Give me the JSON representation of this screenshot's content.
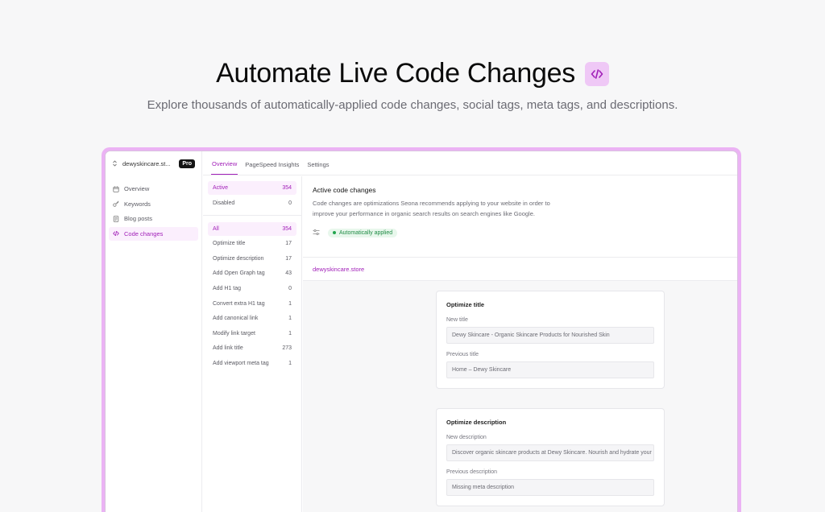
{
  "hero": {
    "title": "Automate Live Code Changes",
    "subtitle": "Explore thousands of automatically-applied code changes, social tags, meta tags, and descriptions.",
    "badge_icon": "code-icon"
  },
  "sidebar": {
    "site_name": "dewyskincare.st...",
    "plan_badge": "Pro",
    "items": [
      {
        "label": "Overview",
        "icon": "calendar-icon"
      },
      {
        "label": "Keywords",
        "icon": "key-icon"
      },
      {
        "label": "Blog posts",
        "icon": "document-icon"
      },
      {
        "label": "Code changes",
        "icon": "code-icon"
      }
    ]
  },
  "tabs": [
    {
      "label": "Overview"
    },
    {
      "label": "PageSpeed Insights"
    },
    {
      "label": "Settings"
    }
  ],
  "status_filters": [
    {
      "label": "Active",
      "count": "354"
    },
    {
      "label": "Disabled",
      "count": "0"
    }
  ],
  "type_filters": [
    {
      "label": "All",
      "count": "354"
    },
    {
      "label": "Optimize title",
      "count": "17"
    },
    {
      "label": "Optimize description",
      "count": "17"
    },
    {
      "label": "Add Open Graph tag",
      "count": "43"
    },
    {
      "label": "Add H1 tag",
      "count": "0"
    },
    {
      "label": "Convert extra H1 tag",
      "count": "1"
    },
    {
      "label": "Add canonical link",
      "count": "1"
    },
    {
      "label": "Modify link target",
      "count": "1"
    },
    {
      "label": "Add link title",
      "count": "273"
    },
    {
      "label": "Add viewport meta tag",
      "count": "1"
    }
  ],
  "main": {
    "heading": "Active code changes",
    "description": "Code changes are optimizations Seona recommends applying to your website in order to improve your performance in organic search results on search engines like Google.",
    "applied_label": "Automatically applied",
    "domain": "dewyskincare.store"
  },
  "cards": [
    {
      "title": "Optimize title",
      "new_label": "New title",
      "new_value": "Dewy Skincare - Organic Skincare Products for Nourished Skin",
      "prev_label": "Previous title",
      "prev_value": "Home – Dewy Skincare"
    },
    {
      "title": "Optimize description",
      "new_label": "New description",
      "new_value": "Discover organic skincare products at Dewy Skincare. Nourish and hydrate your skin",
      "prev_label": "Previous description",
      "prev_value": "Missing meta description"
    }
  ],
  "colors": {
    "accent": "#a11fb8",
    "frame": "#ebb3f4",
    "badge_bg": "#efc8f6",
    "success": "#22a54d"
  }
}
